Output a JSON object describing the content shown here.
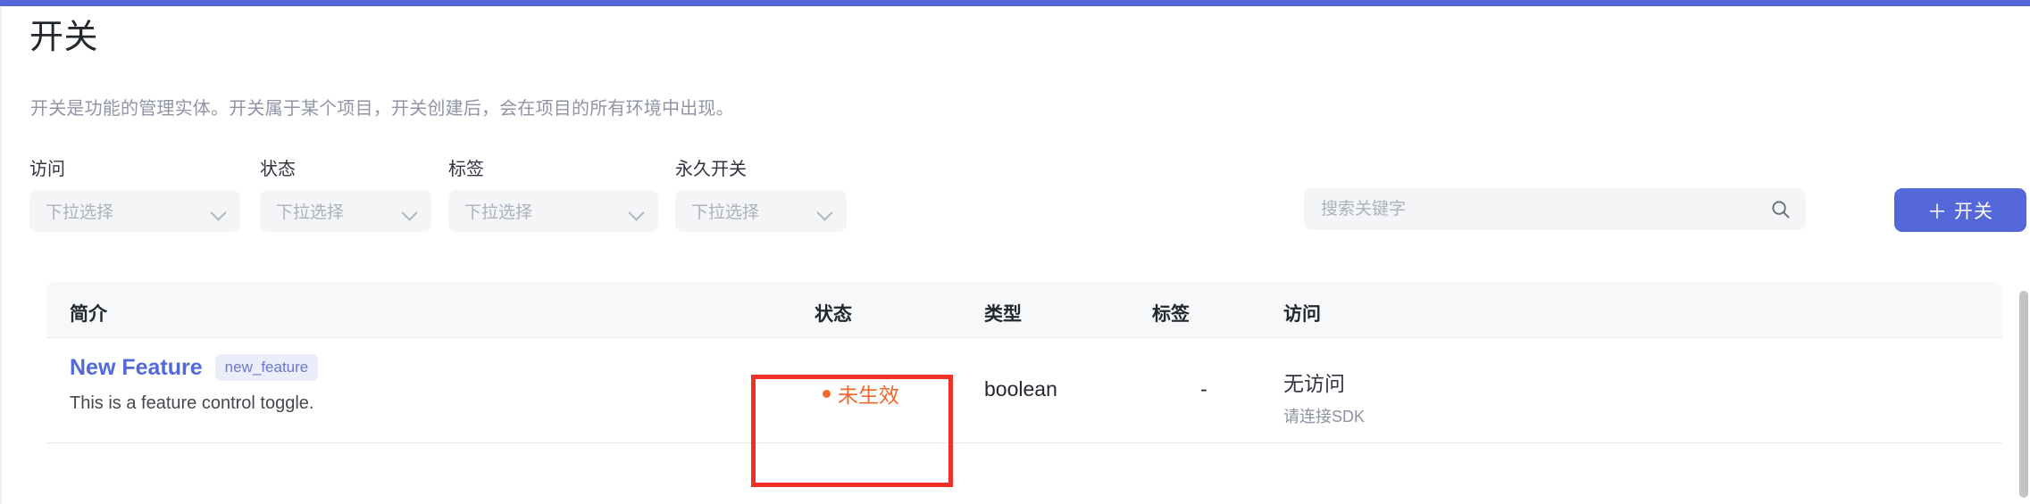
{
  "theme": {
    "accent": "#5468da",
    "annotation_red": "#ee3124",
    "status_orange": "#f0682a",
    "badge_bg": "#ebedfa",
    "header_bg": "#f7f8fa",
    "field_bg": "#f4f5f7"
  },
  "page": {
    "title": "开关",
    "description": "开关是功能的管理实体。开关属于某个项目，开关创建后，会在项目的所有环境中出现。"
  },
  "filters": [
    {
      "label": "访问",
      "placeholder": "下拉选择",
      "value": ""
    },
    {
      "label": "状态",
      "placeholder": "下拉选择",
      "value": ""
    },
    {
      "label": "标签",
      "placeholder": "下拉选择",
      "value": ""
    },
    {
      "label": "永久开关",
      "placeholder": "下拉选择",
      "value": ""
    }
  ],
  "search": {
    "placeholder": "搜索关键字",
    "value": "",
    "icon": "search-icon"
  },
  "actions": {
    "create_label": "开关",
    "create_plus": "＋",
    "dropdown_icon": "chevron-down-icon"
  },
  "table": {
    "columns": [
      "简介",
      "状态",
      "类型",
      "标签",
      "访问"
    ],
    "rows": [
      {
        "name": "New Feature",
        "key": "new_feature",
        "description": "This is a feature control toggle.",
        "status": "未生效",
        "status_indicator": "dot",
        "type": "boolean",
        "tag": "-",
        "access": "无访问",
        "access_hint": "请连接SDK"
      }
    ]
  },
  "annotation": {
    "target": "status-cell",
    "shape": "rectangle",
    "color": "#ee3124"
  }
}
